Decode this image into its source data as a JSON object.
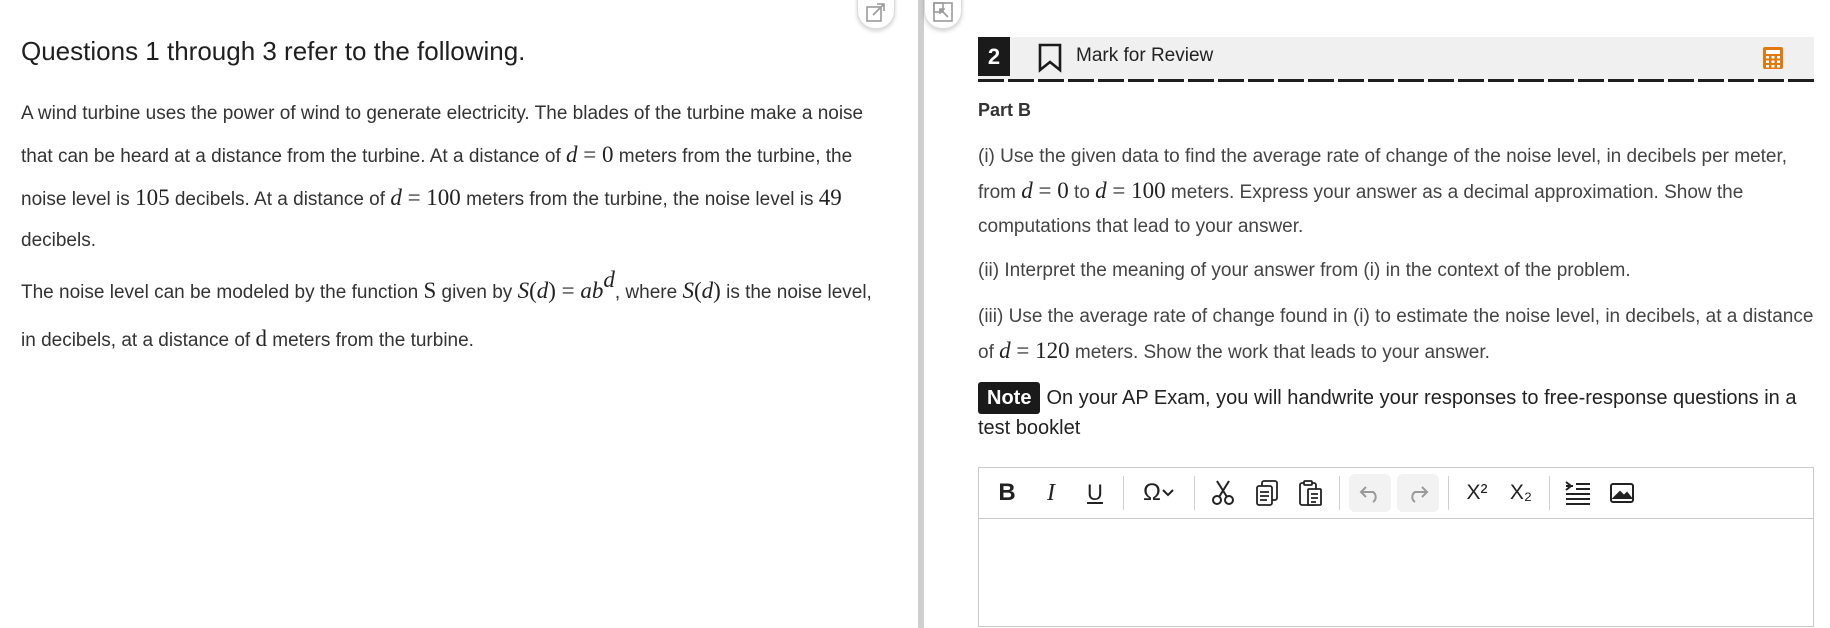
{
  "stimulus": {
    "title": "Questions 1 through 3 refer to the following.",
    "p1": {
      "t1": "A wind turbine uses the power of wind to generate electricity. The blades of the turbine make a noise that can be heard at a distance from the turbine. At a distance of ",
      "m1": "d",
      "m1b": " = 0",
      "t2": " meters from the turbine, the noise level is ",
      "m2": "105",
      "t3": " decibels. At a distance of ",
      "m3": "d",
      "m3b": " = 100",
      "t4": " meters from the turbine, the noise level is ",
      "m4": "49",
      "t5": " decibels."
    },
    "p2": {
      "t1": "The noise level can be modeled by the function ",
      "m1": "S",
      "t2": " given by ",
      "m2a": "S",
      "m2b": "(",
      "m2c": "d",
      "m2d": ") = ",
      "m2e": "ab",
      "m2sup": "d",
      "t3": ", where ",
      "m3a": "S",
      "m3b": "(",
      "m3c": "d",
      "m3d": ")",
      "t4": " is the noise level, in decibels, at a distance of ",
      "m4": "d",
      "t5": " meters from the turbine."
    }
  },
  "question": {
    "number": "2",
    "mark_label": "Mark for Review",
    "part_label": "Part B",
    "q1": {
      "t1": "(i) Use the given data to find the average rate of change of the noise level, in decibels per meter, from ",
      "m1": "d",
      "m1b": " = 0",
      "t2": " to ",
      "m2": "d",
      "m2b": " = 100",
      "t3": " meters. Express your answer as a decimal approximation. Show the computations that lead to your answer."
    },
    "q2": "(ii) Interpret the meaning of your answer from (i) in the context of the problem.",
    "q3": {
      "t1": "(iii) Use the average rate of change found in (i) to estimate the noise level, in decibels, at a distance of ",
      "m1": "d",
      "m1b": " = 120",
      "t2": " meters. Show the work that leads to your answer."
    },
    "note_badge": "Note",
    "note_text": "On your AP Exam, you will handwrite your responses to free-response questions in a test booklet"
  },
  "toolbar": {
    "bold": "B",
    "italic": "I",
    "underline": "U",
    "omega": "Ω",
    "superscript": "X²",
    "subscript": "X₂"
  },
  "colors": {
    "calculator_icon": "#e07a10",
    "header_bg": "#f0f0f0",
    "question_number_bg": "#1a1a1a"
  },
  "icons": [
    "expand-icon",
    "collapse-icon",
    "bookmark-icon",
    "calculator-icon",
    "chevron-down-icon",
    "cut-icon",
    "copy-icon",
    "paste-icon",
    "undo-icon",
    "redo-icon",
    "indent-icon",
    "image-icon"
  ]
}
